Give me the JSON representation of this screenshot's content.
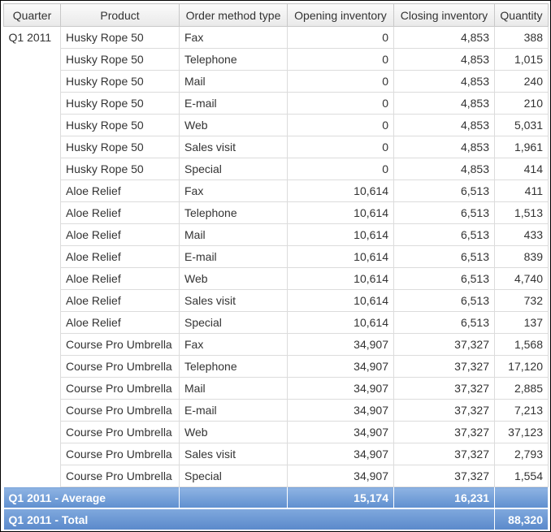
{
  "columns": [
    "Quarter",
    "Product",
    "Order method type",
    "Opening inventory",
    "Closing inventory",
    "Quantity"
  ],
  "quarter": "Q1 2011",
  "rows": [
    [
      "Husky Rope 50",
      "Fax",
      "0",
      "4,853",
      "388"
    ],
    [
      "Husky Rope 50",
      "Telephone",
      "0",
      "4,853",
      "1,015"
    ],
    [
      "Husky Rope 50",
      "Mail",
      "0",
      "4,853",
      "240"
    ],
    [
      "Husky Rope 50",
      "E-mail",
      "0",
      "4,853",
      "210"
    ],
    [
      "Husky Rope 50",
      "Web",
      "0",
      "4,853",
      "5,031"
    ],
    [
      "Husky Rope 50",
      "Sales visit",
      "0",
      "4,853",
      "1,961"
    ],
    [
      "Husky Rope 50",
      "Special",
      "0",
      "4,853",
      "414"
    ],
    [
      "Aloe Relief",
      "Fax",
      "10,614",
      "6,513",
      "411"
    ],
    [
      "Aloe Relief",
      "Telephone",
      "10,614",
      "6,513",
      "1,513"
    ],
    [
      "Aloe Relief",
      "Mail",
      "10,614",
      "6,513",
      "433"
    ],
    [
      "Aloe Relief",
      "E-mail",
      "10,614",
      "6,513",
      "839"
    ],
    [
      "Aloe Relief",
      "Web",
      "10,614",
      "6,513",
      "4,740"
    ],
    [
      "Aloe Relief",
      "Sales visit",
      "10,614",
      "6,513",
      "732"
    ],
    [
      "Aloe Relief",
      "Special",
      "10,614",
      "6,513",
      "137"
    ],
    [
      "Course Pro Umbrella",
      "Fax",
      "34,907",
      "37,327",
      "1,568"
    ],
    [
      "Course Pro Umbrella",
      "Telephone",
      "34,907",
      "37,327",
      "17,120"
    ],
    [
      "Course Pro Umbrella",
      "Mail",
      "34,907",
      "37,327",
      "2,885"
    ],
    [
      "Course Pro Umbrella",
      "E-mail",
      "34,907",
      "37,327",
      "7,213"
    ],
    [
      "Course Pro Umbrella",
      "Web",
      "34,907",
      "37,327",
      "37,123"
    ],
    [
      "Course Pro Umbrella",
      "Sales visit",
      "34,907",
      "37,327",
      "2,793"
    ],
    [
      "Course Pro Umbrella",
      "Special",
      "34,907",
      "37,327",
      "1,554"
    ]
  ],
  "average": {
    "label": "Q1 2011 - Average",
    "product": "",
    "opening": "15,174",
    "closing": "16,231",
    "quantity": ""
  },
  "total": {
    "label": "Q1 2011 - Total",
    "quantity": "88,320"
  },
  "colors": {
    "summary": "#6b97d4",
    "header": "#efefef",
    "grid": "#dcdcdc"
  }
}
